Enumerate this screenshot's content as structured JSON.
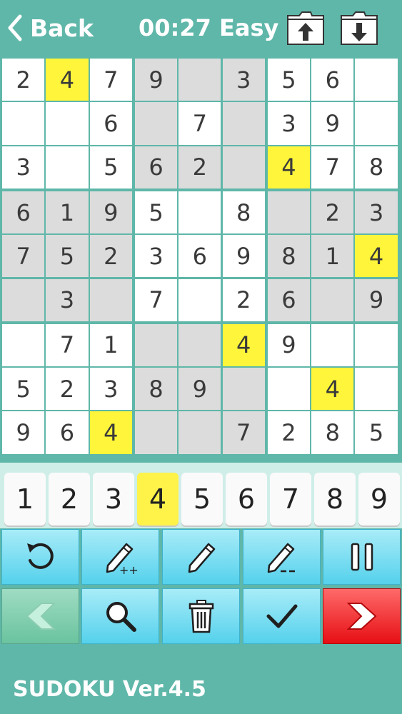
{
  "header": {
    "back_label": "Back",
    "timer_label": "00:27 Easy"
  },
  "board": {
    "grid": [
      [
        "2",
        "4",
        "7",
        "9",
        "",
        "3",
        "5",
        "6",
        ""
      ],
      [
        "",
        "",
        "6",
        "",
        "7",
        "",
        "3",
        "9",
        ""
      ],
      [
        "3",
        "",
        "5",
        "6",
        "2",
        "",
        "4",
        "7",
        "8"
      ],
      [
        "6",
        "1",
        "9",
        "5",
        "",
        "8",
        "",
        "2",
        "3"
      ],
      [
        "7",
        "5",
        "2",
        "3",
        "6",
        "9",
        "8",
        "1",
        "4"
      ],
      [
        "",
        "3",
        "",
        "7",
        "",
        "2",
        "6",
        "",
        "9"
      ],
      [
        "",
        "7",
        "1",
        "",
        "",
        "4",
        "9",
        "",
        ""
      ],
      [
        "5",
        "2",
        "3",
        "8",
        "9",
        "",
        "",
        "4",
        ""
      ],
      [
        "9",
        "6",
        "4",
        "",
        "",
        "7",
        "2",
        "8",
        "5"
      ]
    ],
    "shaded": [
      [
        0,
        0,
        0,
        1,
        1,
        1,
        0,
        0,
        0
      ],
      [
        0,
        0,
        0,
        1,
        0,
        1,
        0,
        0,
        0
      ],
      [
        0,
        0,
        0,
        1,
        1,
        1,
        0,
        0,
        0
      ],
      [
        1,
        1,
        1,
        0,
        0,
        0,
        1,
        1,
        1
      ],
      [
        1,
        1,
        1,
        0,
        0,
        0,
        1,
        1,
        1
      ],
      [
        1,
        1,
        1,
        0,
        0,
        0,
        1,
        1,
        1
      ],
      [
        0,
        0,
        0,
        1,
        1,
        1,
        0,
        0,
        0
      ],
      [
        0,
        0,
        0,
        1,
        1,
        1,
        0,
        0,
        0
      ],
      [
        0,
        0,
        0,
        1,
        1,
        1,
        0,
        0,
        0
      ]
    ],
    "highlight_digit": "4",
    "colors": {
      "white": "#ffffff",
      "shaded": "#dcdcdc",
      "highlight": "#fff53a",
      "grid_line": "#5fb7a9",
      "digit": "#3a3a3a"
    }
  },
  "numpad": {
    "keys": [
      "1",
      "2",
      "3",
      "4",
      "5",
      "6",
      "7",
      "8",
      "9"
    ],
    "selected": "4"
  },
  "tools": {
    "row1": [
      "undo-icon",
      "pencil-plus-icon",
      "pencil-icon",
      "pencil-minus-icon",
      "pause-icon"
    ],
    "row2": [
      "prev-arrow-icon",
      "search-icon",
      "trash-icon",
      "check-icon",
      "next-arrow-icon"
    ]
  },
  "footer": {
    "version_label": "SUDOKU Ver.4.5"
  }
}
